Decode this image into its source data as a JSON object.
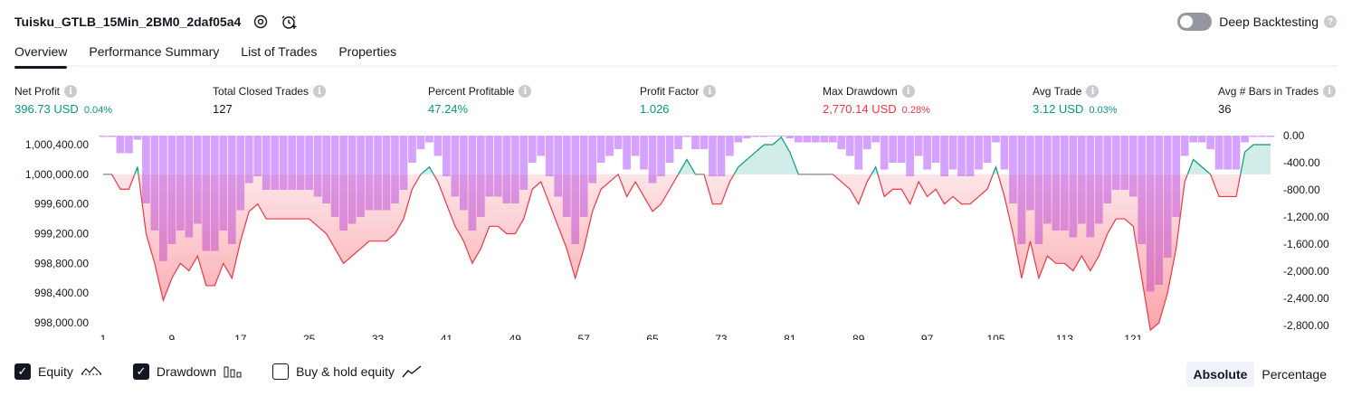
{
  "header": {
    "title": "Tuisku_GTLB_15Min_2BM0_2daf05a4",
    "deep_backtesting": "Deep Backtesting",
    "help": "?"
  },
  "tabs": [
    {
      "label": "Overview"
    },
    {
      "label": "Performance Summary"
    },
    {
      "label": "List of Trades"
    },
    {
      "label": "Properties"
    }
  ],
  "metrics": [
    {
      "label": "Net Profit",
      "value": "396.73 USD",
      "pct": "0.04%",
      "color": "#089981"
    },
    {
      "label": "Total Closed Trades",
      "value": "127",
      "pct": "",
      "color": "#131722"
    },
    {
      "label": "Percent Profitable",
      "value": "47.24%",
      "pct": "",
      "color": "#089981"
    },
    {
      "label": "Profit Factor",
      "value": "1.026",
      "pct": "",
      "color": "#089981"
    },
    {
      "label": "Max Drawdown",
      "value": "2,770.14 USD",
      "pct": "0.28%",
      "color": "#f23645"
    },
    {
      "label": "Avg Trade",
      "value": "3.12 USD",
      "pct": "0.03%",
      "color": "#089981"
    },
    {
      "label": "Avg # Bars in Trades",
      "value": "36",
      "pct": "",
      "color": "#131722"
    }
  ],
  "info_glyph": "i",
  "chart_data": {
    "type": "line",
    "baseline": 1000000,
    "left_ticks": [
      "1,000,400.00",
      "1,000,000.00",
      "999,600.00",
      "999,200.00",
      "998,800.00",
      "998,400.00",
      "998,000.00"
    ],
    "left_tick_values": [
      1000400,
      1000000,
      999600,
      999200,
      998800,
      998400,
      998000
    ],
    "right_ticks": [
      "0.00",
      "-400.00",
      "-800.00",
      "-1,200.00",
      "-1,600.00",
      "-2,000.00",
      "-2,400.00",
      "-2,800.00"
    ],
    "right_tick_values": [
      0,
      -400,
      -800,
      -1200,
      -1600,
      -2000,
      -2400,
      -2800
    ],
    "x_ticks": [
      "1",
      "9",
      "17",
      "25",
      "33",
      "41",
      "49",
      "57",
      "65",
      "73",
      "81",
      "89",
      "97",
      "105",
      "113",
      "121"
    ],
    "x_tick_values": [
      1,
      9,
      17,
      25,
      33,
      41,
      49,
      57,
      65,
      73,
      81,
      89,
      97,
      105,
      113,
      121
    ],
    "equity": [
      1000000,
      1000000,
      999800,
      999800,
      1000100,
      999200,
      998800,
      998300,
      998600,
      998800,
      998700,
      998900,
      998500,
      998500,
      998800,
      998600,
      999100,
      999500,
      999600,
      999400,
      999400,
      999400,
      999400,
      999400,
      999400,
      999300,
      999200,
      999000,
      998800,
      998900,
      999000,
      999100,
      999100,
      999100,
      999200,
      999400,
      999800,
      1000000,
      1000100,
      999900,
      999600,
      999300,
      999100,
      998800,
      999000,
      999300,
      999300,
      999200,
      999200,
      999400,
      999800,
      999900,
      999600,
      999300,
      999000,
      998600,
      999000,
      999500,
      999800,
      999900,
      1000000,
      999700,
      999900,
      999700,
      999500,
      999600,
      999800,
      1000000,
      1000200,
      1000000,
      1000000,
      999600,
      999600,
      999900,
      1000100,
      1000200,
      1000300,
      1000400,
      1000400,
      1000500,
      1000300,
      1000000,
      1000000,
      1000000,
      1000000,
      1000000,
      999900,
      999800,
      999600,
      999900,
      1000100,
      999700,
      999800,
      999800,
      999600,
      999900,
      999700,
      999800,
      999600,
      999700,
      999600,
      999600,
      999700,
      999800,
      1000100,
      999700,
      999200,
      998600,
      999100,
      998600,
      998900,
      998800,
      998800,
      998700,
      998900,
      998700,
      998900,
      999200,
      999400,
      999400,
      999300,
      998600,
      997900,
      998000,
      998400,
      999000,
      999900,
      1000200,
      1000100,
      1000000,
      999700,
      999700,
      999700,
      1000300,
      1000400,
      1000400,
      1000400
    ],
    "drawdown": [
      -20,
      -20,
      -260,
      -260,
      -60,
      -1000,
      -1400,
      -1850,
      -1600,
      -1400,
      -1500,
      -1300,
      -1700,
      -1700,
      -1400,
      -1600,
      -1100,
      -700,
      -600,
      -800,
      -800,
      -800,
      -800,
      -800,
      -800,
      -900,
      -1000,
      -1200,
      -1400,
      -1300,
      -1200,
      -1100,
      -1100,
      -1100,
      -1000,
      -800,
      -400,
      -200,
      -100,
      -300,
      -600,
      -900,
      -1100,
      -1400,
      -1200,
      -900,
      -900,
      -1000,
      -1000,
      -800,
      -400,
      -300,
      -600,
      -900,
      -1200,
      -1600,
      -1200,
      -700,
      -400,
      -300,
      -200,
      -500,
      -300,
      -500,
      -700,
      -600,
      -400,
      -200,
      -20,
      -200,
      -200,
      -600,
      -600,
      -300,
      -100,
      -40,
      -20,
      -20,
      -10,
      -10,
      -40,
      -100,
      -100,
      -100,
      -100,
      -100,
      -200,
      -300,
      -500,
      -200,
      -100,
      -500,
      -400,
      -400,
      -600,
      -300,
      -500,
      -400,
      -600,
      -500,
      -600,
      -600,
      -500,
      -400,
      -100,
      -500,
      -1000,
      -1600,
      -1100,
      -1600,
      -1300,
      -1400,
      -1400,
      -1500,
      -1300,
      -1500,
      -1300,
      -1000,
      -800,
      -800,
      -900,
      -1600,
      -2300,
      -2200,
      -1800,
      -1200,
      -300,
      -100,
      -100,
      -200,
      -500,
      -500,
      -500,
      -100,
      -20,
      -20,
      -20
    ]
  },
  "legend": {
    "equity": "Equity",
    "drawdown": "Drawdown",
    "buy_hold": "Buy & hold equity",
    "check": "✓"
  },
  "mode": {
    "absolute": "Absolute",
    "percentage": "Percentage"
  },
  "colors": {
    "drawdown_bar": "#ce93ff",
    "equity_pos": "#089981",
    "equity_neg": "#f23645",
    "equity_blue": "#2962ff"
  }
}
